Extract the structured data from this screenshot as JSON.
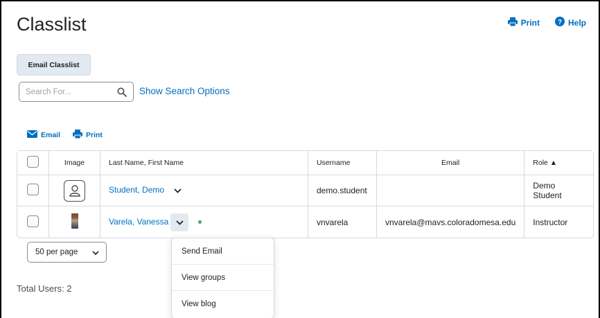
{
  "page": {
    "title": "Classlist"
  },
  "top_actions": {
    "print_label": "Print",
    "help_label": "Help"
  },
  "email_classlist_button": "Email Classlist",
  "search": {
    "placeholder": "Search For...",
    "options_link": "Show Search Options"
  },
  "actions": {
    "email_label": "Email",
    "print_label": "Print"
  },
  "table": {
    "headers": {
      "image": "Image",
      "name": "Last Name, First Name",
      "username": "Username",
      "email": "Email",
      "role": "Role ▲"
    },
    "rows": [
      {
        "name": "Student, Demo",
        "username": "demo.student",
        "email": "",
        "role": "Demo Student",
        "avatar": "default-user-icon"
      },
      {
        "name": "Varela, Vanessa",
        "username": "vnvarela",
        "email": "vnvarela@mavs.coloradomesa.edu",
        "role": "Instructor",
        "avatar": "user-photo",
        "online": true
      }
    ]
  },
  "pagination": {
    "per_page": "50 per page"
  },
  "total_users": "Total Users: 2",
  "context_menu": {
    "items": [
      "Send Email",
      "View groups",
      "View blog"
    ]
  },
  "colors": {
    "link": "#006fbf",
    "button_bg": "#e3e9f1",
    "online": "#46a661",
    "border": "#d3d9e3"
  }
}
